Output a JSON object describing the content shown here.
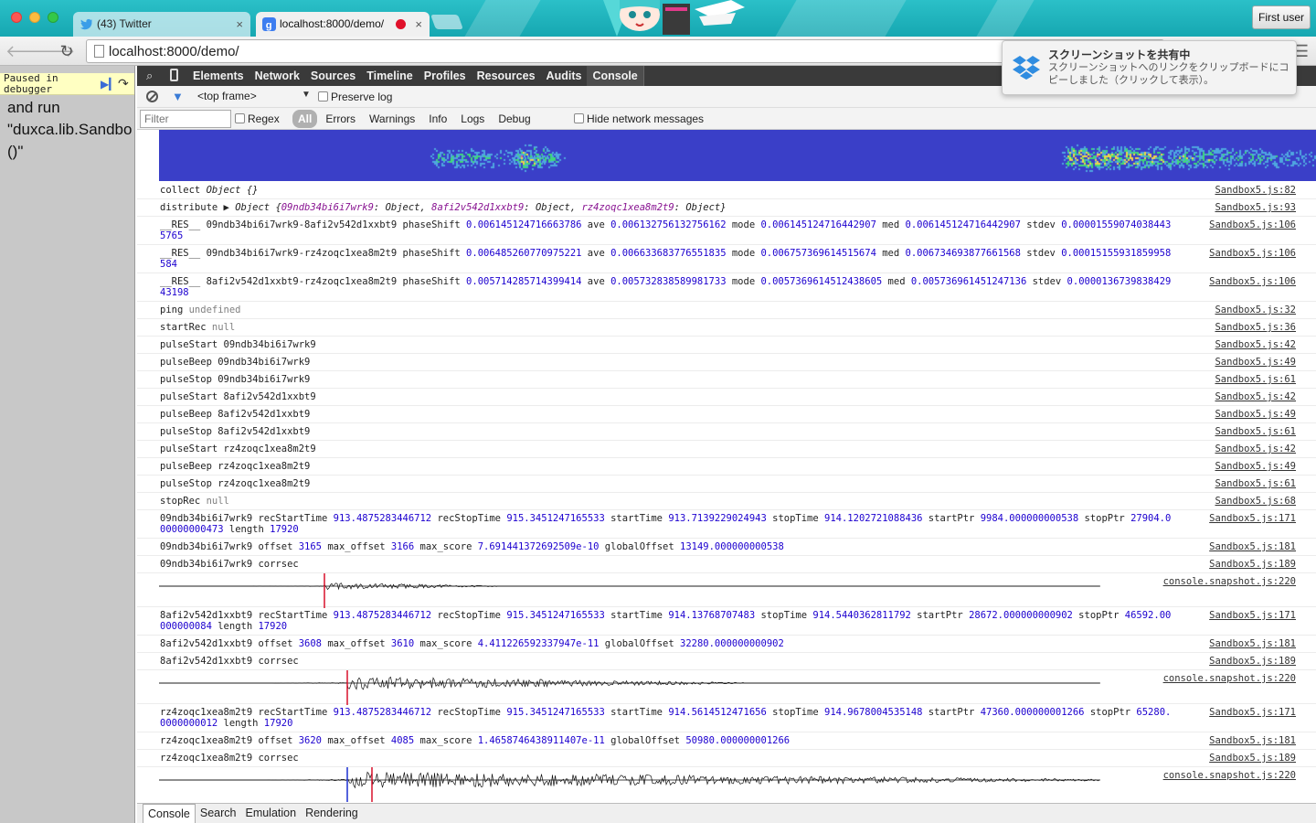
{
  "browser": {
    "tabs": [
      {
        "title": "(43) Twitter",
        "icon": "twitter-bird-icon",
        "close": "×"
      },
      {
        "title": "localhost:8000/demo/",
        "icon": "google-g-icon",
        "close": "×",
        "recording": true
      }
    ],
    "user_button": "First user",
    "url": "localhost:8000/demo/",
    "colors": {
      "titlebar": "#1fb3bc",
      "accent_record": "#e0102a"
    }
  },
  "notification": {
    "title": "スクリーンショットを共有中",
    "body": "スクリーンショットへのリンクをクリップボードにコピーしました（クリックして表示）。",
    "icon": "dropbox-icon"
  },
  "page": {
    "paused_label": "Paused in\ndebugger",
    "text": "and run\n\"duxca.lib.Sandbo\n()\""
  },
  "devtools": {
    "tabs": [
      "Elements",
      "Network",
      "Sources",
      "Timeline",
      "Profiles",
      "Resources",
      "Audits",
      "Console"
    ],
    "active_tab": "Console",
    "frame": "<top frame>",
    "preserve_log": "Preserve log",
    "filter_placeholder": "Filter",
    "regex": "Regex",
    "levels": [
      "All",
      "Errors",
      "Warnings",
      "Info",
      "Logs",
      "Debug"
    ],
    "hide_network": "Hide network messages",
    "drawer_tabs": [
      "Console",
      "Search",
      "Emulation",
      "Rendering"
    ]
  },
  "console": [
    {
      "type": "text",
      "h": 19,
      "src": "Sandbox5.js:82",
      "parts": [
        [
          "collect ",
          ""
        ],
        [
          "Object {}",
          "it"
        ]
      ]
    },
    {
      "type": "text",
      "h": 19,
      "src": "Sandbox5.js:93",
      "parts": [
        [
          "distribute ",
          ""
        ],
        [
          "▶ Object {",
          "it"
        ],
        [
          "09ndb34bi6i7wrk9",
          "key"
        ],
        [
          ": Object, ",
          "it"
        ],
        [
          "8afi2v542d1xxbt9",
          "key"
        ],
        [
          ": Object, ",
          "it"
        ],
        [
          "rz4zoqc1xea8m2t9",
          "key"
        ],
        [
          ": Object}",
          "it"
        ]
      ]
    },
    {
      "type": "text",
      "h": 31,
      "src": "Sandbox5.js:106",
      "parts": [
        [
          "__RES__ 09ndb34bi6i7wrk9-8afi2v542d1xxbt9 phaseShift ",
          ""
        ],
        [
          "0.006145124716663786",
          "num"
        ],
        [
          " ave ",
          ""
        ],
        [
          "0.006132756132756162",
          "num"
        ],
        [
          " mode ",
          ""
        ],
        [
          "0.006145124716442907",
          "num"
        ],
        [
          " med ",
          ""
        ],
        [
          "0.006145124716442907",
          "num"
        ],
        [
          " stdev ",
          ""
        ],
        [
          "0.000015590740384435765",
          "num"
        ]
      ]
    },
    {
      "type": "text",
      "h": 31,
      "src": "Sandbox5.js:106",
      "parts": [
        [
          "__RES__ 09ndb34bi6i7wrk9-rz4zoqc1xea8m2t9 phaseShift ",
          ""
        ],
        [
          "0.006485260770975221",
          "num"
        ],
        [
          " ave ",
          ""
        ],
        [
          "0.006633683776551835",
          "num"
        ],
        [
          " mode ",
          ""
        ],
        [
          "0.006757369614515674",
          "num"
        ],
        [
          " med ",
          ""
        ],
        [
          "0.006734693877661568",
          "num"
        ],
        [
          " stdev ",
          ""
        ],
        [
          "0.00015155931859958584",
          "num"
        ]
      ]
    },
    {
      "type": "text",
      "h": 31,
      "src": "Sandbox5.js:106",
      "parts": [
        [
          "__RES__ 8afi2v542d1xxbt9-rz4zoqc1xea8m2t9 phaseShift ",
          ""
        ],
        [
          "0.005714285714399414",
          "num"
        ],
        [
          " ave ",
          ""
        ],
        [
          "0.005732838589981733",
          "num"
        ],
        [
          " mode ",
          ""
        ],
        [
          "0.005736961451243860​5",
          "num"
        ],
        [
          " med ",
          ""
        ],
        [
          "0.005736961451247136",
          "num"
        ],
        [
          " stdev ",
          ""
        ],
        [
          "0.000013673983842943198",
          "num"
        ]
      ]
    },
    {
      "type": "text",
      "h": 19,
      "src": "Sandbox5.js:32",
      "parts": [
        [
          "ping ",
          ""
        ],
        [
          "undefined",
          "nul"
        ]
      ]
    },
    {
      "type": "text",
      "h": 19,
      "src": "Sandbox5.js:36",
      "parts": [
        [
          "startRec ",
          ""
        ],
        [
          "null",
          "nul"
        ]
      ]
    },
    {
      "type": "text",
      "h": 19,
      "src": "Sandbox5.js:42",
      "parts": [
        [
          "pulseStart 09ndb34bi6i7wrk9",
          ""
        ]
      ]
    },
    {
      "type": "text",
      "h": 19,
      "src": "Sandbox5.js:49",
      "parts": [
        [
          "pulseBeep 09ndb34bi6i7wrk9",
          ""
        ]
      ]
    },
    {
      "type": "text",
      "h": 19,
      "src": "Sandbox5.js:61",
      "parts": [
        [
          "pulseStop 09ndb34bi6i7wrk9",
          ""
        ]
      ]
    },
    {
      "type": "text",
      "h": 19,
      "src": "Sandbox5.js:42",
      "parts": [
        [
          "pulseStart 8afi2v542d1xxbt9",
          ""
        ]
      ]
    },
    {
      "type": "text",
      "h": 19,
      "src": "Sandbox5.js:49",
      "parts": [
        [
          "pulseBeep 8afi2v542d1xxbt9",
          ""
        ]
      ]
    },
    {
      "type": "text",
      "h": 19,
      "src": "Sandbox5.js:61",
      "parts": [
        [
          "pulseStop 8afi2v542d1xxbt9",
          ""
        ]
      ]
    },
    {
      "type": "text",
      "h": 19,
      "src": "Sandbox5.js:42",
      "parts": [
        [
          "pulseStart rz4zoqc1xea8m2t9",
          ""
        ]
      ]
    },
    {
      "type": "text",
      "h": 19,
      "src": "Sandbox5.js:49",
      "parts": [
        [
          "pulseBeep rz4zoqc1xea8m2t9",
          ""
        ]
      ]
    },
    {
      "type": "text",
      "h": 19,
      "src": "Sandbox5.js:61",
      "parts": [
        [
          "pulseStop rz4zoqc1xea8m2t9",
          ""
        ]
      ]
    },
    {
      "type": "text",
      "h": 19,
      "src": "Sandbox5.js:68",
      "parts": [
        [
          "stopRec ",
          ""
        ],
        [
          "null",
          "nul"
        ]
      ]
    },
    {
      "type": "text",
      "h": 31,
      "src": "Sandbox5.js:171",
      "parts": [
        [
          "09ndb34bi6i7wrk9 recStartTime ",
          ""
        ],
        [
          "913.4875283446712",
          "num"
        ],
        [
          " recStopTime ",
          ""
        ],
        [
          "915.3451247165533",
          "num"
        ],
        [
          " startTime ",
          ""
        ],
        [
          "913.7139229024943",
          "num"
        ],
        [
          " stopTime ",
          ""
        ],
        [
          "914.1202721088436",
          "num"
        ],
        [
          " startPtr ",
          ""
        ],
        [
          "9984.000000000538",
          "num"
        ],
        [
          " stopPtr ",
          ""
        ],
        [
          "27904.000000000473",
          "num"
        ],
        [
          " length ",
          ""
        ],
        [
          "17920",
          "num"
        ]
      ]
    },
    {
      "type": "text",
      "h": 19,
      "src": "Sandbox5.js:181",
      "parts": [
        [
          "09ndb34bi6i7wrk9 offset ",
          ""
        ],
        [
          "3165",
          "num"
        ],
        [
          " max_offset ",
          ""
        ],
        [
          "3166",
          "num"
        ],
        [
          " max_score ",
          ""
        ],
        [
          "7.691441372692509e-10",
          "num"
        ],
        [
          " globalOffset ",
          ""
        ],
        [
          "13149.000000000538",
          "num"
        ]
      ]
    },
    {
      "type": "text",
      "h": 19,
      "src": "Sandbox5.js:189",
      "parts": [
        [
          "09ndb34bi6i7wrk9 corrsec",
          ""
        ]
      ]
    },
    {
      "type": "wave",
      "h": 37,
      "src": "console.snapshot.js:220",
      "peak": 181,
      "amp": 0.35,
      "extent": 370,
      "red": [
        181
      ],
      "blue": []
    },
    {
      "type": "text",
      "h": 31,
      "src": "Sandbox5.js:171",
      "parts": [
        [
          "8afi2v542d1xxbt9 recStartTime ",
          ""
        ],
        [
          "913.4875283446712",
          "num"
        ],
        [
          " recStopTime ",
          ""
        ],
        [
          "915.3451247165533",
          "num"
        ],
        [
          " startTime ",
          ""
        ],
        [
          "914.13768707483",
          "num"
        ],
        [
          " stopTime ",
          ""
        ],
        [
          "914.5440362811792",
          "num"
        ],
        [
          " startPtr ",
          ""
        ],
        [
          "28672.000000000902",
          "num"
        ],
        [
          " stopPtr ",
          ""
        ],
        [
          "46592.00000000084",
          "num"
        ],
        [
          " length ",
          ""
        ],
        [
          "17920",
          "num"
        ]
      ]
    },
    {
      "type": "text",
      "h": 19,
      "src": "Sandbox5.js:181",
      "parts": [
        [
          "8afi2v542d1xxbt9 offset ",
          ""
        ],
        [
          "3608",
          "num"
        ],
        [
          " max_offset ",
          ""
        ],
        [
          "3610",
          "num"
        ],
        [
          " max_score ",
          ""
        ],
        [
          "4.411226592337947e-11",
          "num"
        ],
        [
          " globalOffset ",
          ""
        ],
        [
          "32280.000000000902",
          "num"
        ]
      ]
    },
    {
      "type": "text",
      "h": 19,
      "src": "Sandbox5.js:189",
      "parts": [
        [
          "8afi2v542d1xxbt9 corrsec",
          ""
        ]
      ]
    },
    {
      "type": "wave",
      "h": 37,
      "src": "console.snapshot.js:220",
      "peak": 206,
      "amp": 0.6,
      "extent": 640,
      "red": [
        206
      ],
      "blue": []
    },
    {
      "type": "text",
      "h": 31,
      "src": "Sandbox5.js:171",
      "parts": [
        [
          "rz4zoqc1xea8m2t9 recStartTime ",
          ""
        ],
        [
          "913.4875283446712",
          "num"
        ],
        [
          " recStopTime ",
          ""
        ],
        [
          "915.3451247165533",
          "num"
        ],
        [
          " startTime ",
          ""
        ],
        [
          "914.5614512471656",
          "num"
        ],
        [
          " stopTime ",
          ""
        ],
        [
          "914.9678004535148",
          "num"
        ],
        [
          " startPtr ",
          ""
        ],
        [
          "47360.000000001266",
          "num"
        ],
        [
          " stopPtr ",
          ""
        ],
        [
          "65280.0000000012",
          "num"
        ],
        [
          " length ",
          ""
        ],
        [
          "17920",
          "num"
        ]
      ]
    },
    {
      "type": "text",
      "h": 19,
      "src": "Sandbox5.js:181",
      "parts": [
        [
          "rz4zoqc1xea8m2t9 offset ",
          ""
        ],
        [
          "3620",
          "num"
        ],
        [
          " max_offset ",
          ""
        ],
        [
          "4085",
          "num"
        ],
        [
          " max_score ",
          ""
        ],
        [
          "1.4658746438911407e-11",
          "num"
        ],
        [
          " globalOffset ",
          ""
        ],
        [
          "50980.000000001266",
          "num"
        ]
      ]
    },
    {
      "type": "text",
      "h": 19,
      "src": "Sandbox5.js:189",
      "parts": [
        [
          "rz4zoqc1xea8m2t9 corrsec",
          ""
        ]
      ]
    },
    {
      "type": "wave",
      "h": 40,
      "src": "console.snapshot.js:220",
      "peak": 208,
      "amp": 0.75,
      "extent": 1030,
      "red": [
        233
      ],
      "blue": [
        206
      ]
    }
  ]
}
